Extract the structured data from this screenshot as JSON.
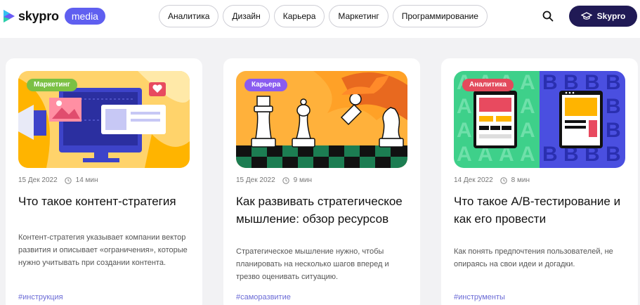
{
  "header": {
    "logo_text": "skypro",
    "media_label": "media",
    "nav": [
      "Аналитика",
      "Дизайн",
      "Карьера",
      "Маркетинг",
      "Программирование"
    ],
    "cta_label": "Skypro",
    "icons": {
      "search": "search-icon",
      "cta": "graduation-cap-icon"
    }
  },
  "colors": {
    "accent": "#5f5ff0",
    "cta_bg": "#201a55",
    "tag_marketing": "#7bc043",
    "tag_career": "#8a5cf0",
    "tag_analytics": "#e34a5c"
  },
  "cards": [
    {
      "tag": "Маркетинг",
      "date": "15 Дек 2022",
      "read_time": "14 мин",
      "title": "Что такое контент-стратегия",
      "description": "Контент-стратегия указывает компании вектор развития и описывает «ограничения», которые нужно учитывать при создании контента.",
      "hashtag": "#инструкция"
    },
    {
      "tag": "Карьера",
      "date": "15 Дек 2022",
      "read_time": "9 мин",
      "title": "Как развивать стратегическое мышление: обзор ресурсов",
      "description": "Стратегическое мышление нужно, чтобы планировать на несколько шагов вперед и трезво оценивать ситуацию.",
      "hashtag": "#саморазвитие"
    },
    {
      "tag": "Аналитика",
      "date": "14 Дек 2022",
      "read_time": "8 мин",
      "title": "Что такое A/B-тестирование и как его провести",
      "description": "Как понять предпочтения пользователей, не опираясь на свои идеи и догадки.",
      "hashtag": "#инструменты",
      "illustration_letters": [
        "A",
        "B"
      ]
    }
  ]
}
